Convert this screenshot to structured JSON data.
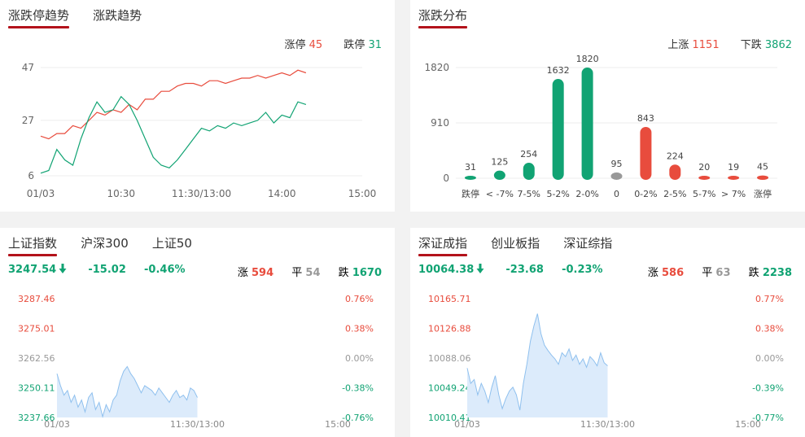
{
  "colors": {
    "up": "#e84c3d",
    "down": "#11a373",
    "flat": "#999999",
    "area_fill": "#dcebfb",
    "area_line": "#8fc0ee",
    "tab_underline": "#b3121b"
  },
  "trend_panel": {
    "tabs": [
      {
        "label": "涨跌停趋势",
        "active": true
      },
      {
        "label": "涨跌趋势",
        "active": false
      }
    ],
    "legend": {
      "limit_up_label": "涨停",
      "limit_up_value": "45",
      "limit_down_label": "跌停",
      "limit_down_value": "31"
    }
  },
  "dist_panel": {
    "tabs": [
      {
        "label": "涨跌分布",
        "active": true
      }
    ],
    "legend": {
      "up_label": "上涨",
      "up_value": "1151",
      "down_label": "下跌",
      "down_value": "3862"
    }
  },
  "sh_panel": {
    "tabs": [
      {
        "label": "上证指数",
        "active": true
      },
      {
        "label": "沪深300",
        "active": false
      },
      {
        "label": "上证50",
        "active": false
      }
    ],
    "quote": {
      "price": "3247.54",
      "direction_icon": "down-arrow-icon",
      "change": "-15.02",
      "percent": "-0.46%",
      "up_label": "涨",
      "up_value": "594",
      "flat_label": "平",
      "flat_value": "54",
      "down_label": "跌",
      "down_value": "1670"
    }
  },
  "sz_panel": {
    "tabs": [
      {
        "label": "深证成指",
        "active": true
      },
      {
        "label": "创业板指",
        "active": false
      },
      {
        "label": "深证综指",
        "active": false
      }
    ],
    "quote": {
      "price": "10064.38",
      "direction_icon": "down-arrow-icon",
      "change": "-23.68",
      "percent": "-0.23%",
      "up_label": "涨",
      "up_value": "586",
      "flat_label": "平",
      "flat_value": "63",
      "down_label": "跌",
      "down_value": "2238"
    }
  },
  "chart_data": [
    {
      "id": "limit-trend",
      "type": "line",
      "x_ticks": [
        "01/03",
        "10:30",
        "11:30/13:00",
        "14:00",
        "15:00"
      ],
      "x_total": 240,
      "y_ticks": [
        "47",
        "27",
        "6"
      ],
      "ylim": [
        6,
        47
      ],
      "series": [
        {
          "name": "涨停",
          "color": "#e84c3d",
          "x": [
            0,
            6,
            12,
            18,
            24,
            30,
            36,
            42,
            48,
            54,
            60,
            66,
            72,
            78,
            84,
            90,
            96,
            102,
            108,
            114,
            120,
            126,
            132,
            138,
            144,
            150,
            156,
            162,
            168,
            174,
            180,
            186,
            192,
            198
          ],
          "values": [
            21,
            20,
            22,
            22,
            25,
            24,
            27,
            30,
            29,
            31,
            30,
            33,
            31,
            35,
            35,
            38,
            38,
            40,
            41,
            41,
            40,
            42,
            42,
            41,
            42,
            43,
            43,
            44,
            43,
            44,
            45,
            44,
            46,
            45
          ]
        },
        {
          "name": "跌停",
          "color": "#11a373",
          "x": [
            0,
            6,
            12,
            18,
            24,
            30,
            36,
            42,
            48,
            54,
            60,
            66,
            72,
            78,
            84,
            90,
            96,
            102,
            108,
            114,
            120,
            126,
            132,
            138,
            144,
            150,
            156,
            162,
            168,
            174,
            180,
            186,
            192,
            198
          ],
          "values": [
            7,
            8,
            16,
            12,
            10,
            20,
            28,
            34,
            30,
            31,
            36,
            33,
            27,
            20,
            13,
            10,
            9,
            12,
            16,
            20,
            24,
            23,
            25,
            24,
            26,
            25,
            26,
            27,
            30,
            26,
            29,
            28,
            34,
            33
          ]
        }
      ]
    },
    {
      "id": "change-distribution",
      "type": "bar",
      "categories": [
        "跌停",
        "< -7%",
        "7-5%",
        "5-2%",
        "2-0%",
        "0",
        "0-2%",
        "2-5%",
        "5-7%",
        "> 7%",
        "涨停"
      ],
      "values": [
        31,
        125,
        254,
        1632,
        1820,
        95,
        843,
        224,
        20,
        19,
        45
      ],
      "colors": [
        "#11a373",
        "#11a373",
        "#11a373",
        "#11a373",
        "#11a373",
        "#999999",
        "#e84c3d",
        "#e84c3d",
        "#e84c3d",
        "#e84c3d",
        "#e84c3d"
      ],
      "y_ticks": [
        "1820",
        "910",
        "0"
      ],
      "ylim": [
        0,
        1820
      ]
    },
    {
      "id": "sh-index",
      "type": "area",
      "x_ticks": [
        "01/03",
        "11:30/13:00",
        "15:00"
      ],
      "x_total": 240,
      "y_ticks_left": [
        "3287.46",
        "3275.01",
        "3262.56",
        "3250.11",
        "3237.66"
      ],
      "y_ticks_right": [
        "0.76%",
        "0.38%",
        "0.00%",
        "-0.38%",
        "-0.76%"
      ],
      "ylim": [
        3237.66,
        3287.46
      ],
      "x": [
        0,
        3,
        6,
        9,
        12,
        15,
        18,
        21,
        24,
        27,
        30,
        33,
        36,
        39,
        42,
        45,
        48,
        51,
        54,
        57,
        60,
        63,
        66,
        69,
        72,
        75,
        78,
        81,
        84,
        87,
        90,
        93,
        96,
        99,
        102,
        105,
        108,
        111,
        114,
        117,
        120
      ],
      "values": [
        3256,
        3251,
        3247,
        3249,
        3244,
        3247,
        3242,
        3245,
        3240,
        3246,
        3248,
        3241,
        3244,
        3238,
        3243,
        3240,
        3245,
        3247,
        3253,
        3257,
        3259,
        3256,
        3254,
        3251,
        3248,
        3251,
        3250,
        3249,
        3247,
        3250,
        3248,
        3246,
        3244,
        3247,
        3249,
        3246,
        3247,
        3245,
        3250,
        3249,
        3246
      ]
    },
    {
      "id": "sz-index",
      "type": "area",
      "x_ticks": [
        "01/03",
        "11:30/13:00",
        "15:00"
      ],
      "x_total": 240,
      "y_ticks_left": [
        "10165.71",
        "10126.88",
        "10088.06",
        "10049.24",
        "10010.41"
      ],
      "y_ticks_right": [
        "0.77%",
        "0.38%",
        "0.00%",
        "-0.39%",
        "-0.77%"
      ],
      "ylim": [
        10010.41,
        10165.71
      ],
      "x": [
        0,
        3,
        6,
        9,
        12,
        15,
        18,
        21,
        24,
        27,
        30,
        33,
        36,
        39,
        42,
        45,
        48,
        51,
        54,
        57,
        60,
        63,
        66,
        69,
        72,
        75,
        78,
        81,
        84,
        87,
        90,
        93,
        96,
        99,
        102,
        105,
        108,
        111,
        114,
        117,
        120
      ],
      "values": [
        10075,
        10055,
        10060,
        10040,
        10055,
        10045,
        10030,
        10050,
        10065,
        10040,
        10022,
        10035,
        10045,
        10050,
        10040,
        10020,
        10055,
        10080,
        10110,
        10130,
        10146,
        10120,
        10105,
        10098,
        10092,
        10087,
        10080,
        10095,
        10090,
        10100,
        10085,
        10092,
        10080,
        10087,
        10076,
        10090,
        10085,
        10078,
        10095,
        10082,
        10078
      ]
    }
  ]
}
